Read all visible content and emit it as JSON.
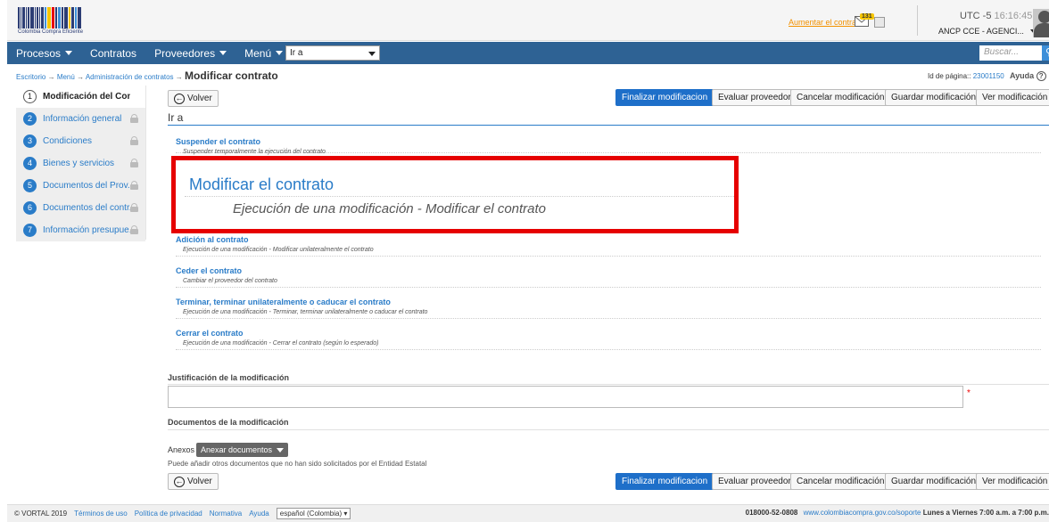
{
  "header": {
    "logo_text": "Colombia Compra Eficiente",
    "contrast_link": "Aumentar el contraste",
    "mail_count": "131",
    "timezone": "UTC -5",
    "time": "16:16:45",
    "agency": "ANCP CCE - AGENCI..."
  },
  "nav": {
    "items": [
      "Procesos",
      "Contratos",
      "Proveedores",
      "Menú"
    ],
    "ira_value": "Ir a",
    "search_placeholder": "Buscar..."
  },
  "breadcrumb": {
    "items": [
      "Escritorio",
      "Menú",
      "Administración de contratos"
    ],
    "current": "Modificar contrato",
    "page_id_label": "Id de página::",
    "page_id": "23001150",
    "help": "Ayuda"
  },
  "sidebar": {
    "steps": [
      {
        "num": "1",
        "label": "Modificación del Contrato"
      },
      {
        "num": "2",
        "label": "Información general"
      },
      {
        "num": "3",
        "label": "Condiciones"
      },
      {
        "num": "4",
        "label": "Bienes y servicios"
      },
      {
        "num": "5",
        "label": "Documentos del Prov..."
      },
      {
        "num": "6",
        "label": "Documentos del contr..."
      },
      {
        "num": "7",
        "label": "Información presupue..."
      }
    ]
  },
  "toolbar": {
    "back": "Volver",
    "finalize": "Finalizar modificacion",
    "evaluate": "Evaluar proveedor",
    "cancel": "Cancelar modificación",
    "save": "Guardar modificación",
    "view": "Ver modificación"
  },
  "ira_section": {
    "title": "Ir a",
    "options": [
      {
        "title": "Suspender el contrato",
        "desc": "Suspender temporalmente la ejecución del contrato"
      },
      {
        "title": "Adición al contrato",
        "desc": "Ejecución de una modificación - Modificar unilateralmente el contrato"
      },
      {
        "title": "Ceder el contrato",
        "desc": "Cambiar el proveedor del contrato"
      },
      {
        "title": "Terminar, terminar unilateralmente o caducar el contrato",
        "desc": "Ejecución de una modificación - Terminar, terminar unilateralmente o caducar el contrato"
      },
      {
        "title": "Cerrar el contrato",
        "desc": "Ejecución de una modificación - Cerrar el contrato (según lo esperado)"
      }
    ],
    "highlight": {
      "title": "Modificar el contrato",
      "desc": "Ejecución de una modificación - Modificar el contrato"
    }
  },
  "justification": {
    "label": "Justificación de la modificación",
    "required_mark": "*"
  },
  "documents": {
    "label": "Documentos de la modificación",
    "anexos_label": "Anexos",
    "anexos_button": "Anexar documentos",
    "note": "Puede añadir otros documentos que no han sido solicitados por el Entidad Estatal"
  },
  "footer": {
    "copyright": "© VORTAL 2019",
    "links": [
      "Términos de uso",
      "Política de privacidad",
      "Normativa",
      "Ayuda"
    ],
    "language": "español (Colombia)",
    "phone": "018000-52-0808",
    "support_url": "www.colombiacompra.gov.co/soporte",
    "hours": "Lunes a Viernes 7:00 a.m. a 7:00 p.m."
  },
  "colors": {
    "accent": "#1e6fc9",
    "nav": "#2e6294",
    "highlight_border": "#e60000",
    "link": "#2a7cc8"
  }
}
